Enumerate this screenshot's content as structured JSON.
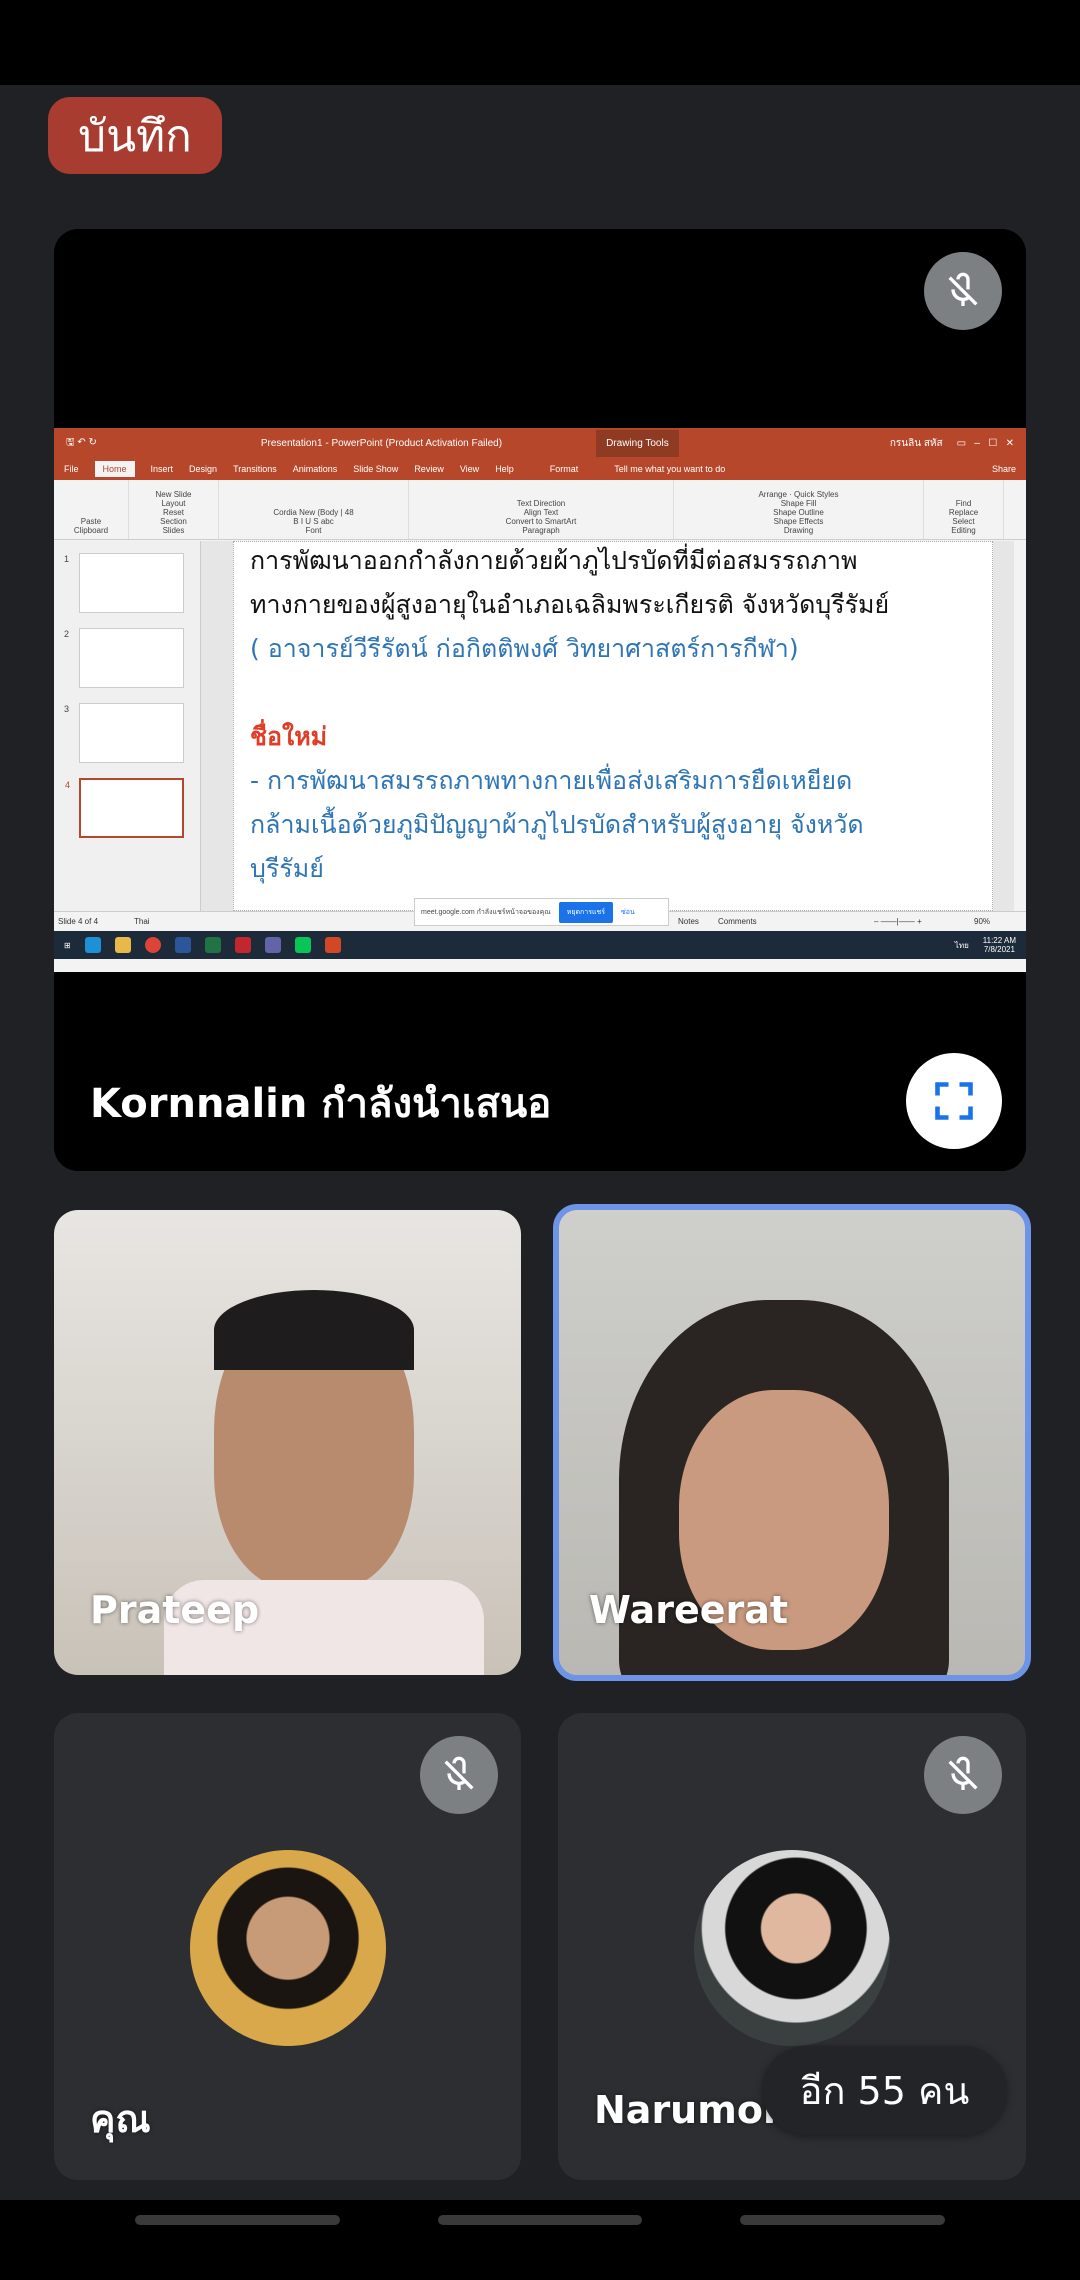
{
  "record_badge": "บันทึก",
  "presentation": {
    "presenter_label": "Kornnalin กำลังนำเสนอ",
    "ppt": {
      "window_title": "Presentation1 - PowerPoint (Product Activation Failed)",
      "drawing_tools": "Drawing Tools",
      "user": "กรนลิน สหัส",
      "tabs": [
        "File",
        "Home",
        "Insert",
        "Design",
        "Transitions",
        "Animations",
        "Slide Show",
        "Review",
        "View",
        "Help",
        "Format"
      ],
      "tell_me": "Tell me what you want to do",
      "share": "Share",
      "ribbon_groups": [
        "Clipboard",
        "Slides",
        "Font",
        "Paragraph",
        "Drawing",
        "Editing"
      ],
      "ribbon_items": {
        "paste": "Paste",
        "new_slide": "New Slide",
        "layout": "Layout",
        "reset": "Reset",
        "section": "Section",
        "font": "Cordia New (Body",
        "size": "48",
        "text_direction": "Text Direction",
        "align_text": "Align Text",
        "convert": "Convert to SmartArt",
        "arrange": "Arrange",
        "quick_styles": "Quick Styles",
        "shape_fill": "Shape Fill",
        "shape_outline": "Shape Outline",
        "shape_effects": "Shape Effects",
        "find": "Find",
        "replace": "Replace",
        "select": "Select"
      },
      "slide_numbers": [
        "1",
        "2",
        "3",
        "4"
      ],
      "slide_lines": {
        "line1": "การพัฒนาออกกำลังกายด้วยผ้าภูไปรบัดที่มีต่อสมรรถภาพ",
        "line2": "ทางกายของผู้สูงอายุในอำเภอเฉลิมพระเกียรติ จังหวัดบุรีรัมย์",
        "line3": "( อาจารย์วีรีรัตน์  ก่อกิตติพงศ์  วิทยาศาสตร์การกีฬา)",
        "line4": "ชื่อใหม่",
        "line5": "- การพัฒนาสมรรถภาพทางกายเพื่อส่งเสริมการยืดเหยียด",
        "line6": "กล้ามเนื้อด้วยภูมิปัญญาผ้าภูไปรบัดสำหรับผู้สูงอายุ จังหวัด",
        "line7": "บุรีรัมย์"
      },
      "status": {
        "slide": "Slide 4 of 4",
        "language": "Thai",
        "notes": "Notes",
        "comments": "Comments",
        "zoom": "90%"
      },
      "popup": {
        "text": "meet.google.com กำลังแชร์หน้าจอของคุณ",
        "stop": "หยุดการแชร์",
        "hide": "ซ่อน"
      },
      "clock": {
        "time": "11:22 AM",
        "date": "7/8/2021",
        "lang": "ไทย"
      }
    }
  },
  "participants": [
    {
      "name": "Prateep",
      "muted": false
    },
    {
      "name": "Wareerat",
      "muted": false,
      "speaking": true
    },
    {
      "name": "คุณ",
      "muted": true
    },
    {
      "name": "Narumon",
      "muted": true
    }
  ],
  "more_participants": "อีก 55 คน",
  "colors": {
    "background": "#202124",
    "record": "#a83c30",
    "speaking_border": "#6d94e6",
    "ppt_accent": "#b7472a",
    "slide_blue": "#2e75b6",
    "slide_red": "#e03c28"
  }
}
